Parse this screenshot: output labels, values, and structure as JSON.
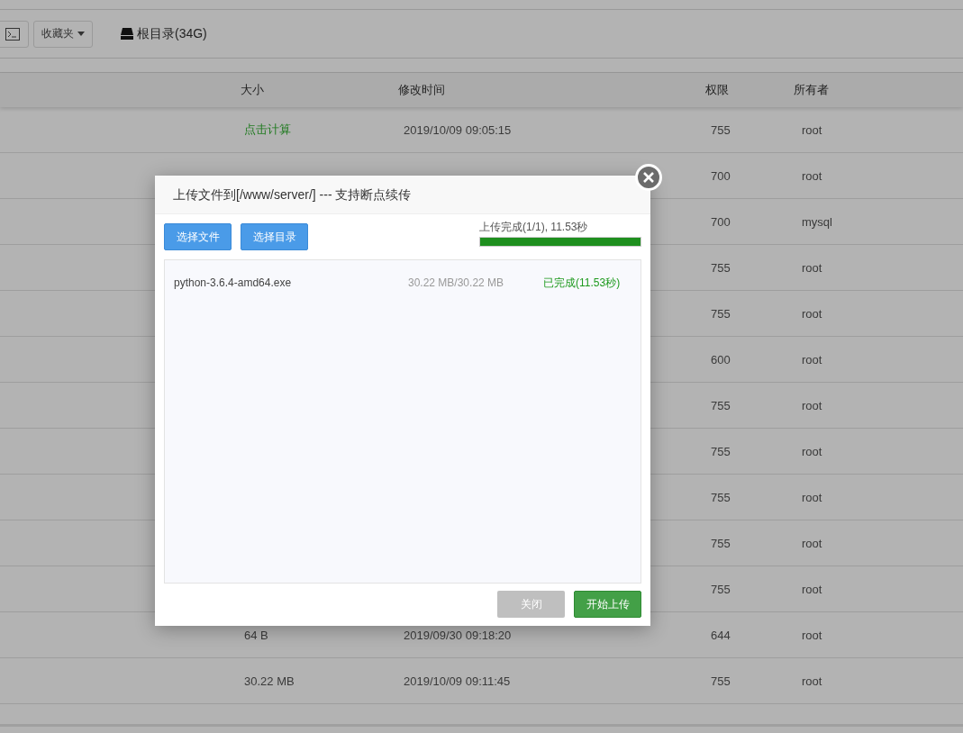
{
  "toolbar": {
    "favorites": "收藏夹",
    "root": "根目录(34G)"
  },
  "table": {
    "columns": [
      "大小",
      "修改时间",
      "权限",
      "所有者"
    ],
    "rows": [
      {
        "size": {
          "text": "点击计算",
          "clickable": true
        },
        "modified": "2019/10/09 09:05:15",
        "permission": "755",
        "owner": "root"
      },
      {
        "permission": "700",
        "owner": "root"
      },
      {
        "permission": "700",
        "owner": "mysql"
      },
      {
        "permission": "755",
        "owner": "root"
      },
      {
        "permission": "755",
        "owner": "root"
      },
      {
        "permission": "600",
        "owner": "root"
      },
      {
        "permission": "755",
        "owner": "root"
      },
      {
        "permission": "755",
        "owner": "root"
      },
      {
        "permission": "755",
        "owner": "root"
      },
      {
        "permission": "755",
        "owner": "root"
      },
      {
        "permission": "755",
        "owner": "root"
      },
      {
        "size": {
          "text": "64 B",
          "clickable": false
        },
        "modified": "2019/09/30 09:18:20",
        "permission": "644",
        "owner": "root"
      },
      {
        "size": {
          "text": "30.22 MB",
          "clickable": false
        },
        "modified": "2019/10/09 09:11:45",
        "permission": "755",
        "owner": "root"
      }
    ]
  },
  "dialog": {
    "title": "上传文件到[/www/server/] --- 支持断点续传",
    "buttons": [
      "选择文件",
      "选择目录"
    ],
    "progress": {
      "label": "上传完成(1/1), 11.53秒",
      "level": 1
    },
    "files": [
      {
        "name": "python-3.6.4-amd64.exe",
        "size": "30.22 MB/30.22 MB",
        "status": "已完成(11.53秒)"
      }
    ],
    "footer": [
      {
        "label": "关闭",
        "kind": "close",
        "disabled": true
      },
      {
        "label": "开始上传",
        "kind": "primary",
        "disabled": false
      }
    ]
  }
}
